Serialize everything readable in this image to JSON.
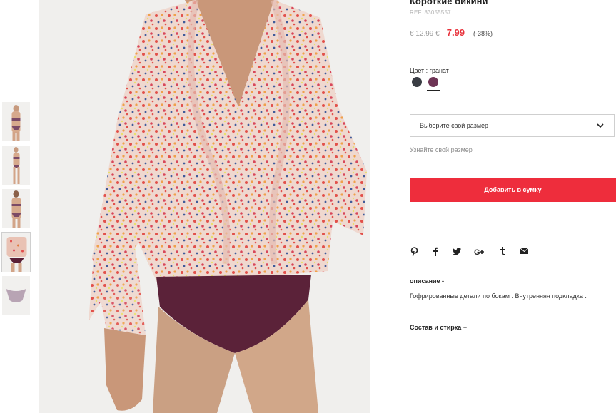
{
  "product": {
    "title": "Короткие бикини",
    "ref": "REF. 83055557",
    "old_price": "€ 12.99 €",
    "new_price": "7.99",
    "discount": "(-38%)"
  },
  "color": {
    "label": "Цвет : гранат",
    "swatches": [
      {
        "name": "dark-grey",
        "hex": "#3a3d44"
      },
      {
        "name": "garnet",
        "hex": "#6e3455"
      }
    ]
  },
  "size": {
    "select_text": "Выберите свой размер",
    "guide_link": "Узнайте свой размер"
  },
  "cart": {
    "add_label": "Добавить в сумку"
  },
  "social": [
    "pinterest-icon",
    "facebook-icon",
    "twitter-icon",
    "google-plus-icon",
    "tumblr-icon",
    "email-icon"
  ],
  "description": {
    "heading": "описание -",
    "text": "Гофрированные детали по бокам . Внутренняя подкладка ."
  },
  "composition": {
    "heading": "Состав и стирка +"
  },
  "colors": {
    "accent": "#ee2d3c",
    "sale": "#e8333c"
  }
}
